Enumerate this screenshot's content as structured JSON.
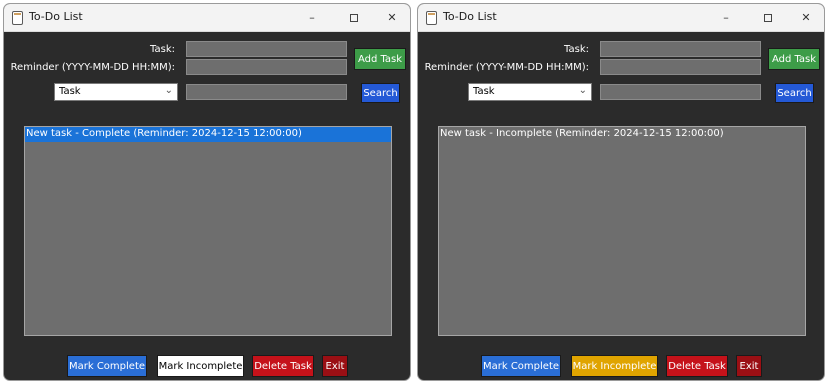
{
  "colors": {
    "window_bg": "#2b2b2b",
    "field_bg": "#6e6e6e",
    "add_button": "#3d9c48",
    "search_button": "#2459d6",
    "mark_complete_button": "#2a6ed6",
    "mark_incomplete_active": "#e0a400",
    "delete_button": "#c5121a",
    "exit_button": "#9a0f14",
    "selection": "#1a73d8"
  },
  "windows": [
    {
      "title": "To-Do List",
      "controls": {
        "minimize": "–",
        "close": "✕"
      },
      "form": {
        "task_label": "Task:",
        "reminder_label": "Reminder (YYYY-MM-DD HH:MM):",
        "task_value": "",
        "reminder_value": "",
        "search_value": ""
      },
      "filter": {
        "selected": "Task"
      },
      "buttons": {
        "add": "Add Task",
        "search": "Search",
        "mark_complete": "Mark Complete",
        "mark_incomplete": "Mark Incomplete",
        "delete": "Delete Task",
        "exit": "Exit"
      },
      "tasks": [
        {
          "text": "New task - Complete (Reminder: 2024-12-15 12:00:00)",
          "selected": true
        }
      ]
    },
    {
      "title": "To-Do List",
      "controls": {
        "minimize": "–",
        "close": "✕"
      },
      "form": {
        "task_label": "Task:",
        "reminder_label": "Reminder (YYYY-MM-DD HH:MM):",
        "task_value": "",
        "reminder_value": "",
        "search_value": ""
      },
      "filter": {
        "selected": "Task"
      },
      "buttons": {
        "add": "Add Task",
        "search": "Search",
        "mark_complete": "Mark Complete",
        "mark_incomplete": "Mark Incomplete",
        "delete": "Delete Task",
        "exit": "Exit"
      },
      "tasks": [
        {
          "text": "New task - Incomplete (Reminder: 2024-12-15 12:00:00)",
          "selected": false
        }
      ]
    }
  ]
}
